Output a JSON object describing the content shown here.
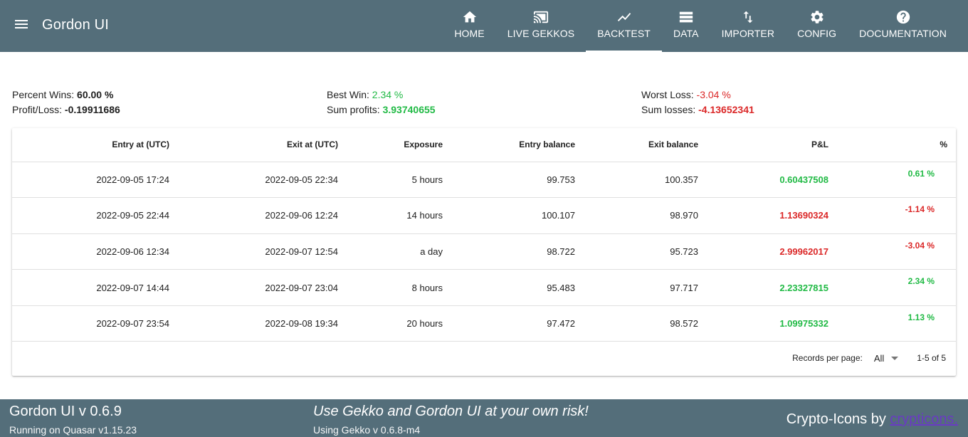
{
  "header": {
    "title": "Gordon UI",
    "nav": [
      {
        "label": "HOME",
        "icon": "home-icon"
      },
      {
        "label": "LIVE GEKKOS",
        "icon": "cast-icon"
      },
      {
        "label": "BACKTEST",
        "icon": "chart-line-icon",
        "active": true
      },
      {
        "label": "DATA",
        "icon": "storage-icon"
      },
      {
        "label": "IMPORTER",
        "icon": "import-export-icon"
      },
      {
        "label": "CONFIG",
        "icon": "gear-icon"
      },
      {
        "label": "DOCUMENTATION",
        "icon": "help-icon"
      }
    ]
  },
  "stats": {
    "percent_wins_label": "Percent Wins:",
    "percent_wins": "60.00 %",
    "profit_loss_label": "Profit/Loss:",
    "profit_loss": "-0.19911686",
    "best_win_label": "Best Win:",
    "best_win": "2.34 %",
    "sum_profits_label": "Sum profits:",
    "sum_profits": "3.93740655",
    "worst_loss_label": "Worst Loss:",
    "worst_loss": "-3.04 %",
    "sum_losses_label": "Sum losses:",
    "sum_losses": "-4.13652341"
  },
  "table": {
    "columns": [
      "Entry at (UTC)",
      "Exit at (UTC)",
      "Exposure",
      "Entry balance",
      "Exit balance",
      "P&L",
      "%"
    ],
    "rows": [
      {
        "entry": "2022-09-05 17:24",
        "exit": "2022-09-05 22:34",
        "exposure": "5 hours",
        "entry_balance": "99.753",
        "exit_balance": "100.357",
        "pl": "0.60437508",
        "pct": "0.61 %",
        "positive": true
      },
      {
        "entry": "2022-09-05 22:44",
        "exit": "2022-09-06 12:24",
        "exposure": "14 hours",
        "entry_balance": "100.107",
        "exit_balance": "98.970",
        "pl": "1.13690324",
        "pct": "-1.14 %",
        "positive": false
      },
      {
        "entry": "2022-09-06 12:34",
        "exit": "2022-09-07 12:54",
        "exposure": "a day",
        "entry_balance": "98.722",
        "exit_balance": "95.723",
        "pl": "2.99962017",
        "pct": "-3.04 %",
        "positive": false
      },
      {
        "entry": "2022-09-07 14:44",
        "exit": "2022-09-07 23:04",
        "exposure": "8 hours",
        "entry_balance": "95.483",
        "exit_balance": "97.717",
        "pl": "2.23327815",
        "pct": "2.34 %",
        "positive": true
      },
      {
        "entry": "2022-09-07 23:54",
        "exit": "2022-09-08 19:34",
        "exposure": "20 hours",
        "entry_balance": "97.472",
        "exit_balance": "98.572",
        "pl": "1.09975332",
        "pct": "1.13 %",
        "positive": true
      }
    ],
    "records_per_page_label": "Records per page:",
    "records_per_page": "All",
    "pagination": "1-5 of 5"
  },
  "footer": {
    "title": "Gordon UI v 0.6.9",
    "subtitle": "Running on Quasar v1.15.23",
    "warning": "Use Gekko and Gordon UI at your own risk!",
    "gekko_version": "Using Gekko v 0.6.8-m4",
    "credits_prefix": "Crypto-Icons by ",
    "credits_link": "crypticons."
  },
  "colors": {
    "header_bg": "#546e7a",
    "positive": "#21ba45",
    "negative": "#db2828"
  }
}
